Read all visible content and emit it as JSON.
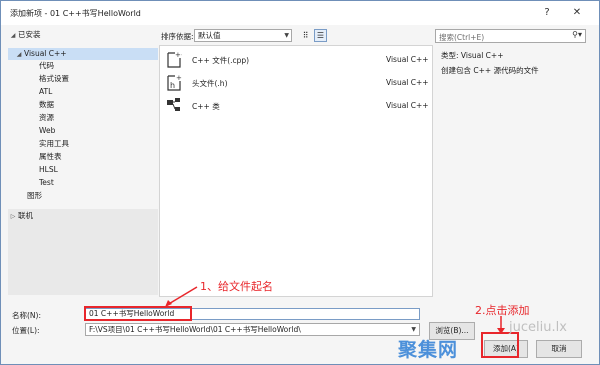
{
  "window": {
    "title": "添加新项 - 01 C++书写HelloWorld",
    "help_label": "?",
    "close_label": "✕"
  },
  "tree": {
    "installed_label": "已安装",
    "items": [
      {
        "label": "Visual C++"
      },
      {
        "label": "代码"
      },
      {
        "label": "格式设置"
      },
      {
        "label": "ATL"
      },
      {
        "label": "数据"
      },
      {
        "label": "资源"
      },
      {
        "label": "Web"
      },
      {
        "label": "实用工具"
      },
      {
        "label": "属性表"
      },
      {
        "label": "HLSL"
      },
      {
        "label": "Test"
      },
      {
        "label": "图形"
      }
    ],
    "online_label": "联机"
  },
  "toolbar": {
    "sort_label": "排序依据:",
    "sort_value": "默认值",
    "grid_view_icon": "grid-view-icon",
    "list_view_icon": "list-view-icon"
  },
  "templates": [
    {
      "name": "C++ 文件(.cpp)",
      "lang": "Visual C++",
      "icon": "cpp-file-icon"
    },
    {
      "name": "头文件(.h)",
      "lang": "Visual C++",
      "icon": "header-file-icon"
    },
    {
      "name": "C++ 类",
      "lang": "Visual C++",
      "icon": "class-icon"
    }
  ],
  "search": {
    "placeholder": "搜索(Ctrl+E)",
    "icon": "search-icon"
  },
  "details": {
    "type_line": "类型:  Visual C++",
    "description": "创建包含 C++ 源代码的文件"
  },
  "form": {
    "name_label": "名称(N):",
    "name_value": "01 C++书写HelloWorld",
    "location_label": "位置(L):",
    "location_value": "F:\\VS项目\\01 C++书写HelloWorld\\01 C++书写HelloWorld\\"
  },
  "buttons": {
    "browse": "浏览(B)...",
    "add": "添加(A)",
    "cancel": "取消"
  },
  "annotations": {
    "step1": "1、给文件起名",
    "step2": "2.点击添加"
  },
  "watermark": {
    "text": "聚集网",
    "site": "juceliu.lx"
  },
  "colors": {
    "accent": "#2f7fd6",
    "annotation": "#e8262b",
    "selection": "#c9def5"
  }
}
